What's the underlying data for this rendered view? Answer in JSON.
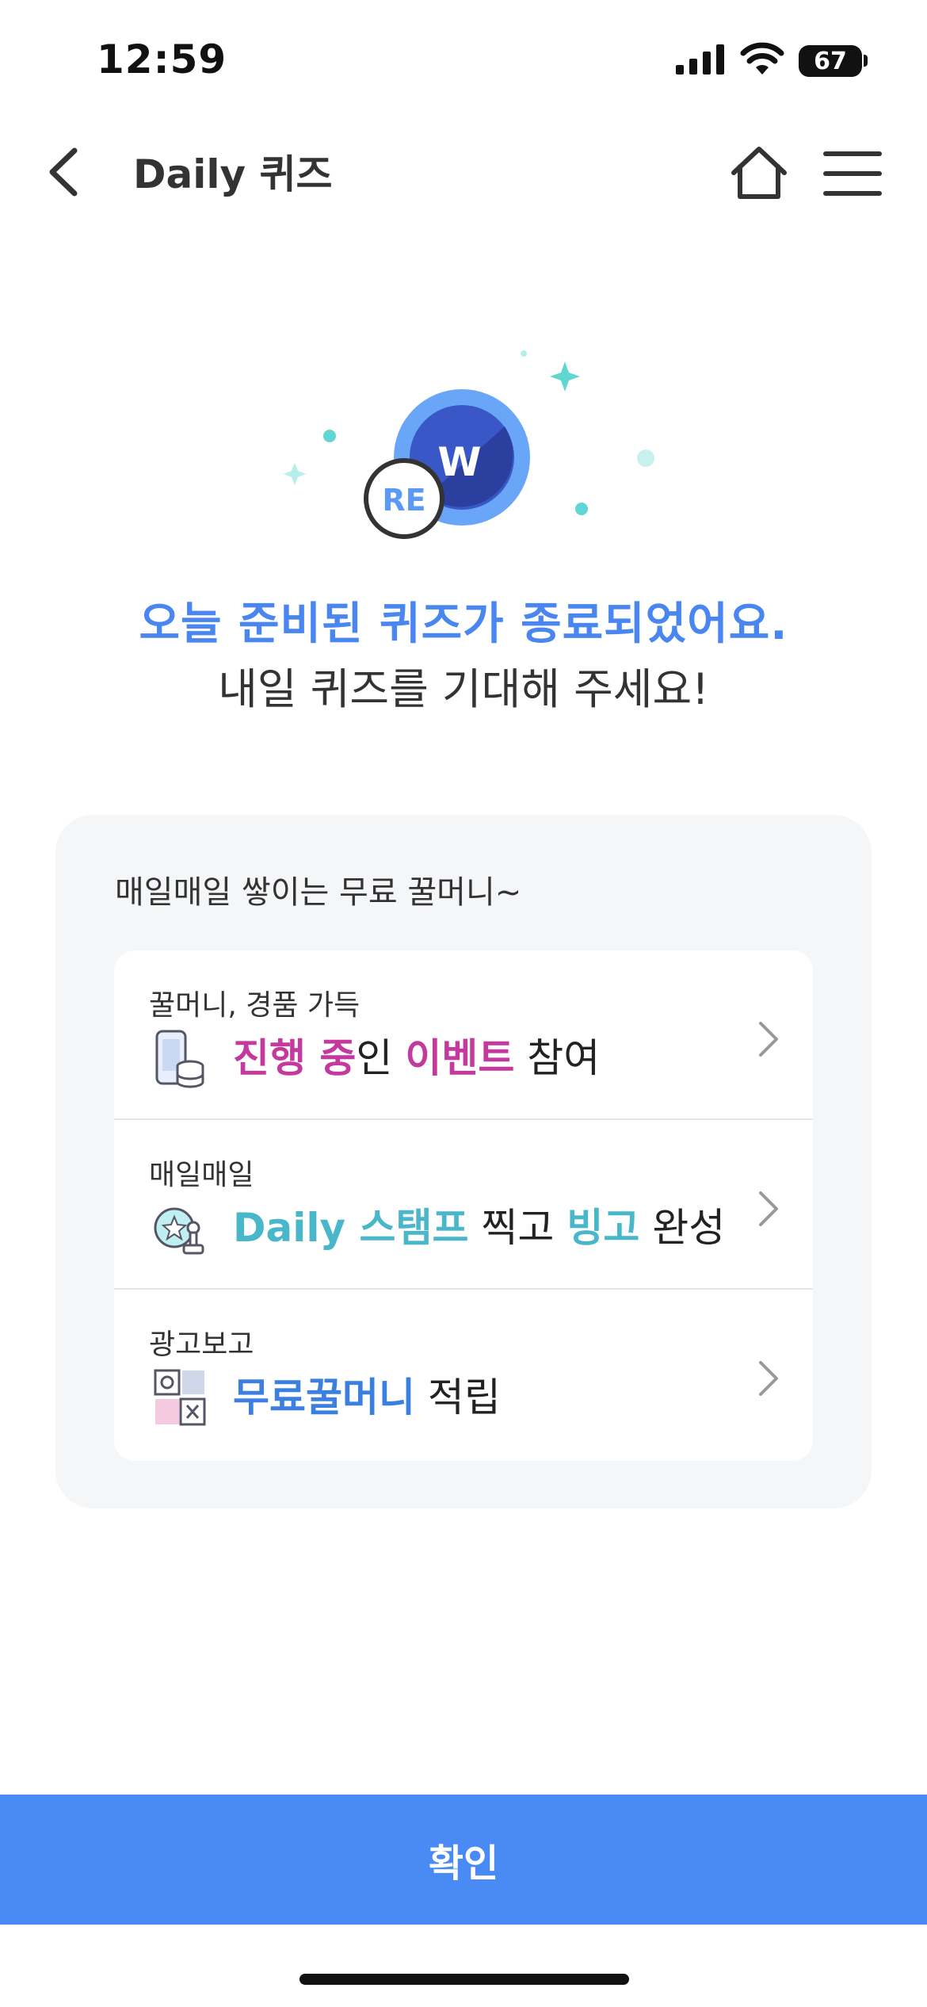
{
  "status_bar": {
    "time": "12:59",
    "battery": "67"
  },
  "header": {
    "title": "Daily 퀴즈"
  },
  "badges": {
    "left": "RE",
    "right": "W"
  },
  "message": {
    "title": "오늘 준비된 퀴즈가 종료되었어요.",
    "subtitle": "내일 퀴즈를 기대해 주세요!"
  },
  "card": {
    "title": "매일매일 쌓이는 무료 꿀머니~",
    "items": [
      {
        "caption": "꿀머니, 경품 가득",
        "icon": "phone-coins-icon",
        "segments": [
          {
            "text": "진행 중",
            "hl": true,
            "color": "#c4399e"
          },
          {
            "text": "인 ",
            "hl": false
          },
          {
            "text": "이벤트",
            "hl": true,
            "color": "#c4399e"
          },
          {
            "text": " 참여",
            "hl": false
          }
        ]
      },
      {
        "caption": "매일매일",
        "icon": "stamp-icon",
        "segments": [
          {
            "text": "Daily 스탬프",
            "hl": true,
            "color": "#49b6c9"
          },
          {
            "text": " 찍고 ",
            "hl": false
          },
          {
            "text": "빙고",
            "hl": true,
            "color": "#49b6c9"
          },
          {
            "text": " 완성",
            "hl": false
          }
        ]
      },
      {
        "caption": "광고보고",
        "icon": "ad-icon",
        "segments": [
          {
            "text": "무료꿀머니",
            "hl": true,
            "color": "#3b7fe0"
          },
          {
            "text": " 적립",
            "hl": false
          }
        ]
      }
    ]
  },
  "confirm_label": "확인",
  "colors": {
    "accent": "#4a8af4",
    "title_blue": "#4a86f0",
    "pink": "#c4399e",
    "teal": "#49b6c9"
  }
}
